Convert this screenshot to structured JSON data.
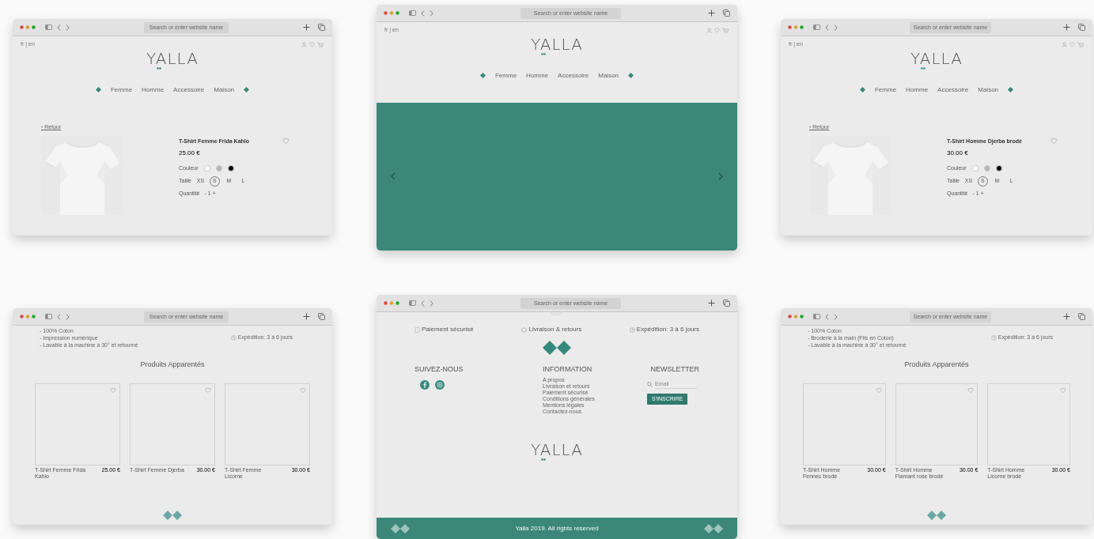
{
  "windows": [
    {
      "kind": "product",
      "url_placeholder": "Search or enter website name",
      "lang": "fr | en",
      "logo": "YALLA",
      "nav": [
        "Femme",
        "Homme",
        "Accessoire",
        "Maison"
      ],
      "back": "‹ Retour",
      "title": "T-Shirt Femme Frida Kahlo",
      "price": "25.00 €",
      "color_label": "Couleur",
      "swatches": [
        {
          "color": "#ffffff"
        },
        {
          "color": "#b3b3b3"
        },
        {
          "color": "#000000"
        }
      ],
      "size_label": "Taille",
      "sizes": [
        {
          "label": "XS",
          "selected": false
        },
        {
          "label": "S",
          "selected": true
        },
        {
          "label": "M",
          "selected": false
        },
        {
          "label": "L",
          "selected": false
        }
      ],
      "quantity_label": "Quantité",
      "quantity": "- 1 +"
    },
    {
      "kind": "home",
      "url_placeholder": "Search or enter website name",
      "lang": "fr | en",
      "logo": "YALLA",
      "nav": [
        "Femme",
        "Homme",
        "Accessoire",
        "Maison"
      ]
    },
    {
      "kind": "product",
      "url_placeholder": "Search or enter website name",
      "lang": "fr | en",
      "logo": "YALLA",
      "nav": [
        "Femme",
        "Homme",
        "Accessoire",
        "Maison"
      ],
      "back": "‹ Retour",
      "title": "T-Shirt Homme Djerba brodé",
      "price": "30.00 €",
      "color_label": "Couleur",
      "swatches": [
        {
          "color": "#ffffff"
        },
        {
          "color": "#b3b3b3"
        },
        {
          "color": "#000000"
        }
      ],
      "size_label": "Taille",
      "sizes": [
        {
          "label": "XS",
          "selected": false
        },
        {
          "label": "S",
          "selected": true
        },
        {
          "label": "M",
          "selected": false
        },
        {
          "label": "L",
          "selected": false
        }
      ],
      "quantity_label": "Quantité",
      "quantity": "- 1 +"
    },
    {
      "kind": "related",
      "url_placeholder": "Search or enter website name",
      "details": [
        "- 100% Coton",
        "- Impression numérique",
        "- Lavable à la machine à 30° et retourné"
      ],
      "shipping": "Expédition: 3 à 6 jours",
      "heading": "Produits Apparentés",
      "products": [
        {
          "name": "T-Shirt Femme Frida Kahlo",
          "price": "25.00 €"
        },
        {
          "name": "T-Shirt Femme Djerba",
          "price": "30.00 €"
        },
        {
          "name": "T-Shirt Femme Licorne",
          "price": "30.00 €"
        }
      ]
    },
    {
      "kind": "footer",
      "url_placeholder": "Search or enter website name",
      "features": [
        "Paiement sécurisé",
        "Livraison & retours",
        "Expédition: 3 à 6 jours"
      ],
      "follow_heading": "SUIVEZ-NOUS",
      "info_heading": "INFORMATION",
      "info_links": [
        "A propos",
        "Livraison et retours",
        "Paiement sécurisé",
        "Conditions générales",
        "Mentions légales",
        "Contactez-nous"
      ],
      "newsletter_heading": "NEWSLETTER",
      "email_placeholder": "Email",
      "subscribe": "S'INSCRIRE",
      "logo": "YALLA",
      "copyright": "Yalla 2019. All rights reserved"
    },
    {
      "kind": "related",
      "url_placeholder": "Search or enter website name",
      "details": [
        "- 100% Coton",
        "- Broderie à la main (Fils en Coton)",
        "- Lavable à la machine à 30° et retourné"
      ],
      "shipping": "Expédition: 3 à 6 jours",
      "heading": "Produits Apparentés",
      "products": [
        {
          "name": "T-Shirt Homme Fennec brodé",
          "price": "30.00 €"
        },
        {
          "name": "T-Shirt Homme Flamant rose brodé",
          "price": "30.00 €"
        },
        {
          "name": "T-Shirt Homme Licorne brodé",
          "price": "30.00 €"
        }
      ]
    }
  ]
}
